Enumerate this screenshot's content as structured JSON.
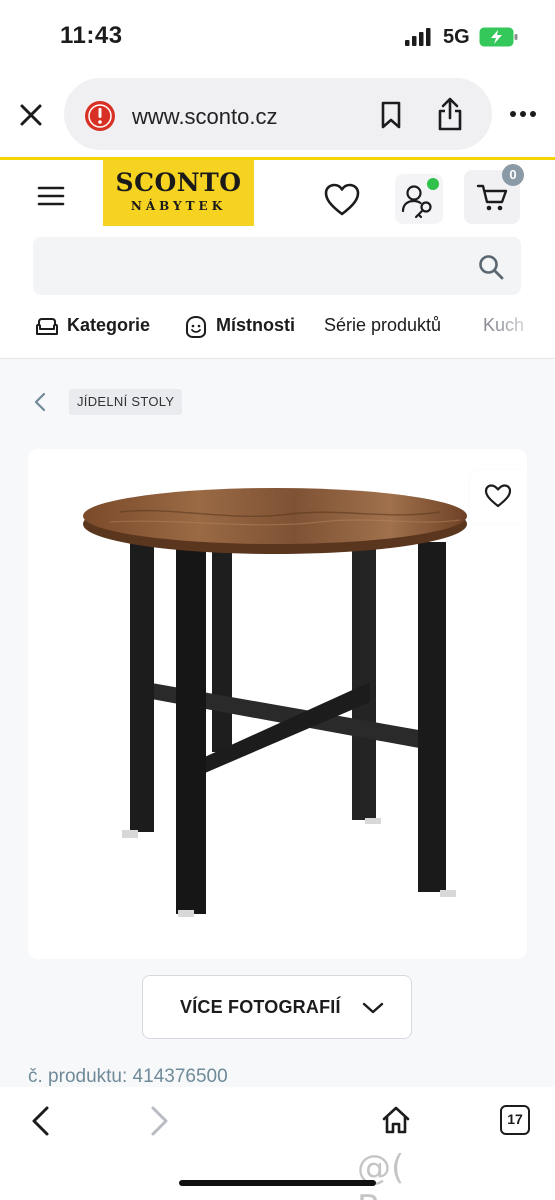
{
  "status_bar": {
    "time": "11:43",
    "network": "5G"
  },
  "browser": {
    "url": "www.sconto.cz",
    "tab_count": "17"
  },
  "site": {
    "logo_line1": "SCONTO",
    "logo_line2": "NÁBYTEK",
    "cart_count": "0",
    "search_placeholder": ""
  },
  "category_nav": {
    "items": [
      {
        "label": "Kategorie",
        "icon": "sofa-icon"
      },
      {
        "label": "Místnosti",
        "icon": "smile-icon"
      },
      {
        "label": "Série produktů"
      },
      {
        "label": "Kuch"
      }
    ]
  },
  "breadcrumb": {
    "label": "JÍDELNÍ STOLY"
  },
  "product": {
    "more_photos_label": "VÍCE FOTOGRAFIÍ",
    "product_number": "č. produktu: 414376500"
  },
  "watermark": "@( Bazos.cz",
  "colors": {
    "brand_yellow": "#f7d321",
    "online_green": "#2ec24a",
    "wood": "#8a5a35",
    "metal": "#1f1f1f"
  }
}
